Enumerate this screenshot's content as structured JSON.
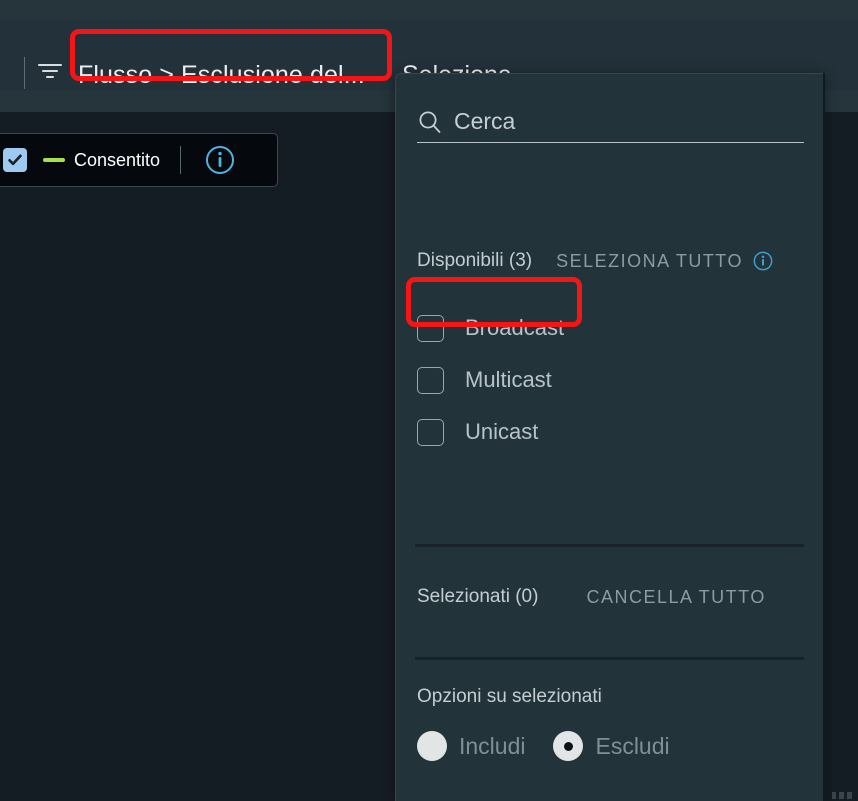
{
  "window": {
    "background_color": "#151d24",
    "panel_color": "#22333a",
    "accent_color": "#5aaedd",
    "highlight_color": "#f41616"
  },
  "tabbar": {
    "filter_icon": "filter-icon",
    "active_tab": "Flusso > Esclusione del...",
    "second_tab": "Seleziona"
  },
  "legend": {
    "checkbox_checked": true,
    "swatch_color": "#a8e04a",
    "label": "Consentito",
    "info_icon": "info-icon"
  },
  "panel": {
    "search": {
      "placeholder": "Cerca",
      "value": "",
      "icon": "search-icon"
    },
    "available": {
      "label": "Disponibili (3)",
      "select_all_label": "SELEZIONA TUTTO",
      "info_icon": "info-icon"
    },
    "options": [
      {
        "label": "Broadcast",
        "checked": false
      },
      {
        "label": "Multicast",
        "checked": false
      },
      {
        "label": "Unicast",
        "checked": false
      }
    ],
    "selected": {
      "label": "Selezionati (0)",
      "clear_all_label": "CANCELLA TUTTO"
    },
    "options_on_selected": {
      "title": "Opzioni su selezionati",
      "radios": [
        {
          "label": "Includi",
          "selected": false
        },
        {
          "label": "Escludi",
          "selected": true
        }
      ]
    }
  },
  "annotations": [
    {
      "name": "tab-highlight",
      "target": "Flusso > Esclusione del..."
    },
    {
      "name": "multicast-highlight",
      "target": "Multicast"
    }
  ]
}
